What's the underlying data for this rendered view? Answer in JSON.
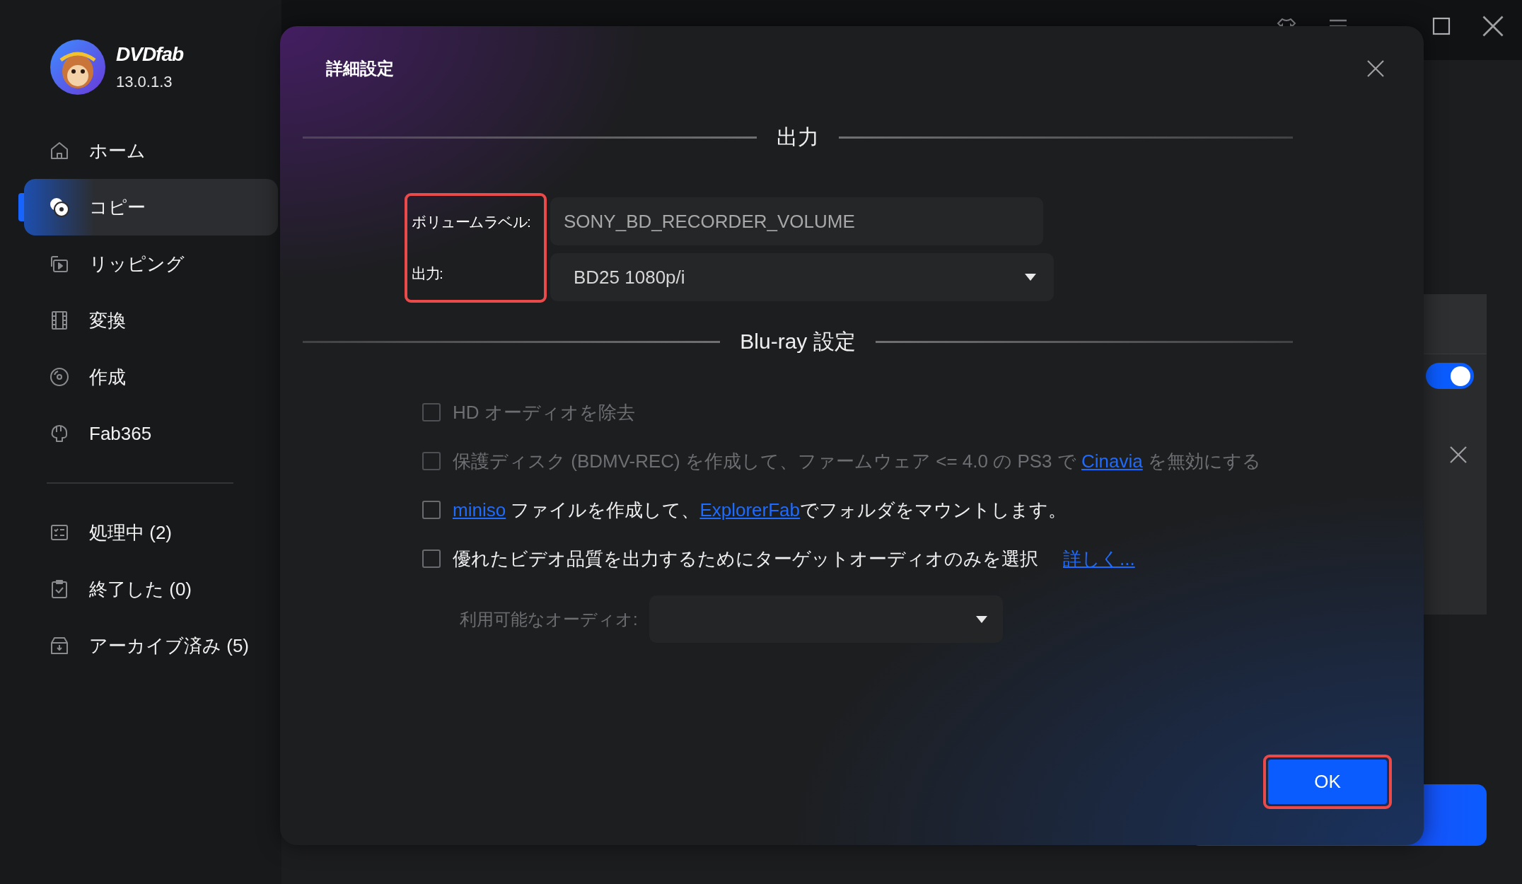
{
  "app": {
    "name": "DVDfab",
    "version": "13.0.1.3"
  },
  "sidebar": {
    "items": [
      {
        "label": "ホーム",
        "selected": false
      },
      {
        "label": "コピー",
        "selected": true
      },
      {
        "label": "リッピング",
        "selected": false
      },
      {
        "label": "変換",
        "selected": false
      },
      {
        "label": "作成",
        "selected": false
      },
      {
        "label": "Fab365",
        "selected": false
      }
    ],
    "queue_items": [
      {
        "label": "処理中 (2)",
        "selected": false
      },
      {
        "label": "終了した (0)",
        "selected": false
      },
      {
        "label": "アーカイブ済み (5)",
        "selected": false
      }
    ]
  },
  "background": {
    "toggle": {
      "on": true
    }
  },
  "dialog": {
    "title": "詳細設定",
    "output_section": {
      "heading": "出力",
      "volume_label": {
        "label": "ボリュームラベル:",
        "value": "SONY_BD_RECORDER_VOLUME"
      },
      "output": {
        "label": "出力:",
        "value": "BD25 1080p/i"
      }
    },
    "bluray_section": {
      "heading": "Blu-ray 設定",
      "options": [
        {
          "checked": false,
          "disabled": true,
          "parts": [
            {
              "text": "HD オーディオを除去",
              "link": false
            }
          ]
        },
        {
          "checked": false,
          "disabled": true,
          "parts": [
            {
              "text": "保護ディスク (BDMV-REC) を作成して、ファームウェア <= 4.0 の PS3 で ",
              "link": false
            },
            {
              "text": "Cinavia",
              "link": true
            },
            {
              "text": " を無効にする",
              "link": false
            }
          ]
        },
        {
          "checked": false,
          "disabled": false,
          "parts": [
            {
              "text": "miniso",
              "link": true
            },
            {
              "text": " ファイルを作成して、",
              "link": false
            },
            {
              "text": "ExplorerFab",
              "link": true
            },
            {
              "text": "でフォルダをマウントします。",
              "link": false
            }
          ]
        },
        {
          "checked": false,
          "disabled": false,
          "parts": [
            {
              "text": "優れたビデオ品質を出力するためにターゲットオーディオのみを選択",
              "link": false
            }
          ],
          "more_link": "詳しく..."
        }
      ],
      "audio": {
        "label": "利用可能なオーディオ:",
        "disabled": true
      }
    },
    "ok_button": "OK"
  }
}
